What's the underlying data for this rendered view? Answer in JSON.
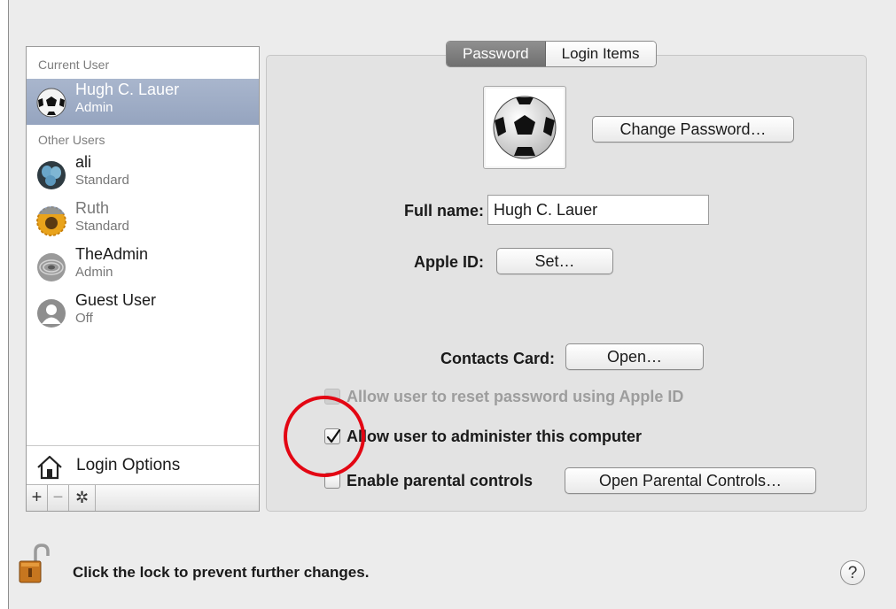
{
  "sidebar": {
    "current_user_label": "Current User",
    "other_users_label": "Other Users",
    "current_user": {
      "name": "Hugh C. Lauer",
      "role": "Admin",
      "icon": "soccer-ball-icon"
    },
    "other_users": [
      {
        "name": "ali",
        "role": "Standard",
        "icon": "blue-eggs-icon"
      },
      {
        "name": "Ruth",
        "role": "Standard",
        "icon": "sunflower-icon"
      },
      {
        "name": "TheAdmin",
        "role": "Admin",
        "icon": "zen-stone-icon"
      },
      {
        "name": "Guest User",
        "role": "Off",
        "icon": "guest-silhouette-icon"
      }
    ],
    "login_options": "Login Options",
    "tools": {
      "add": "+",
      "remove": "−",
      "action": "✲"
    }
  },
  "tabs": [
    {
      "label": "Password",
      "active": true
    },
    {
      "label": "Login Items",
      "active": false
    }
  ],
  "account": {
    "change_password": "Change Password…",
    "full_name_label": "Full name:",
    "full_name_value": "Hugh C. Lauer",
    "apple_id_label": "Apple ID:",
    "apple_id_button": "Set…",
    "contacts_card_label": "Contacts Card:",
    "contacts_card_button": "Open…"
  },
  "options": {
    "reset_password": {
      "label": "Allow user to reset password using Apple ID",
      "checked": false,
      "enabled": false
    },
    "administer": {
      "label": "Allow user to administer this computer",
      "checked": true,
      "enabled": true
    },
    "parental": {
      "label": "Enable parental controls",
      "checked": false,
      "enabled": true
    },
    "parental_button": "Open Parental Controls…"
  },
  "footer": {
    "lock_text": "Click the lock to prevent further changes.",
    "help": "?"
  },
  "colors": {
    "annotation_circle": "#e30613",
    "selection": "#9eadc6"
  }
}
